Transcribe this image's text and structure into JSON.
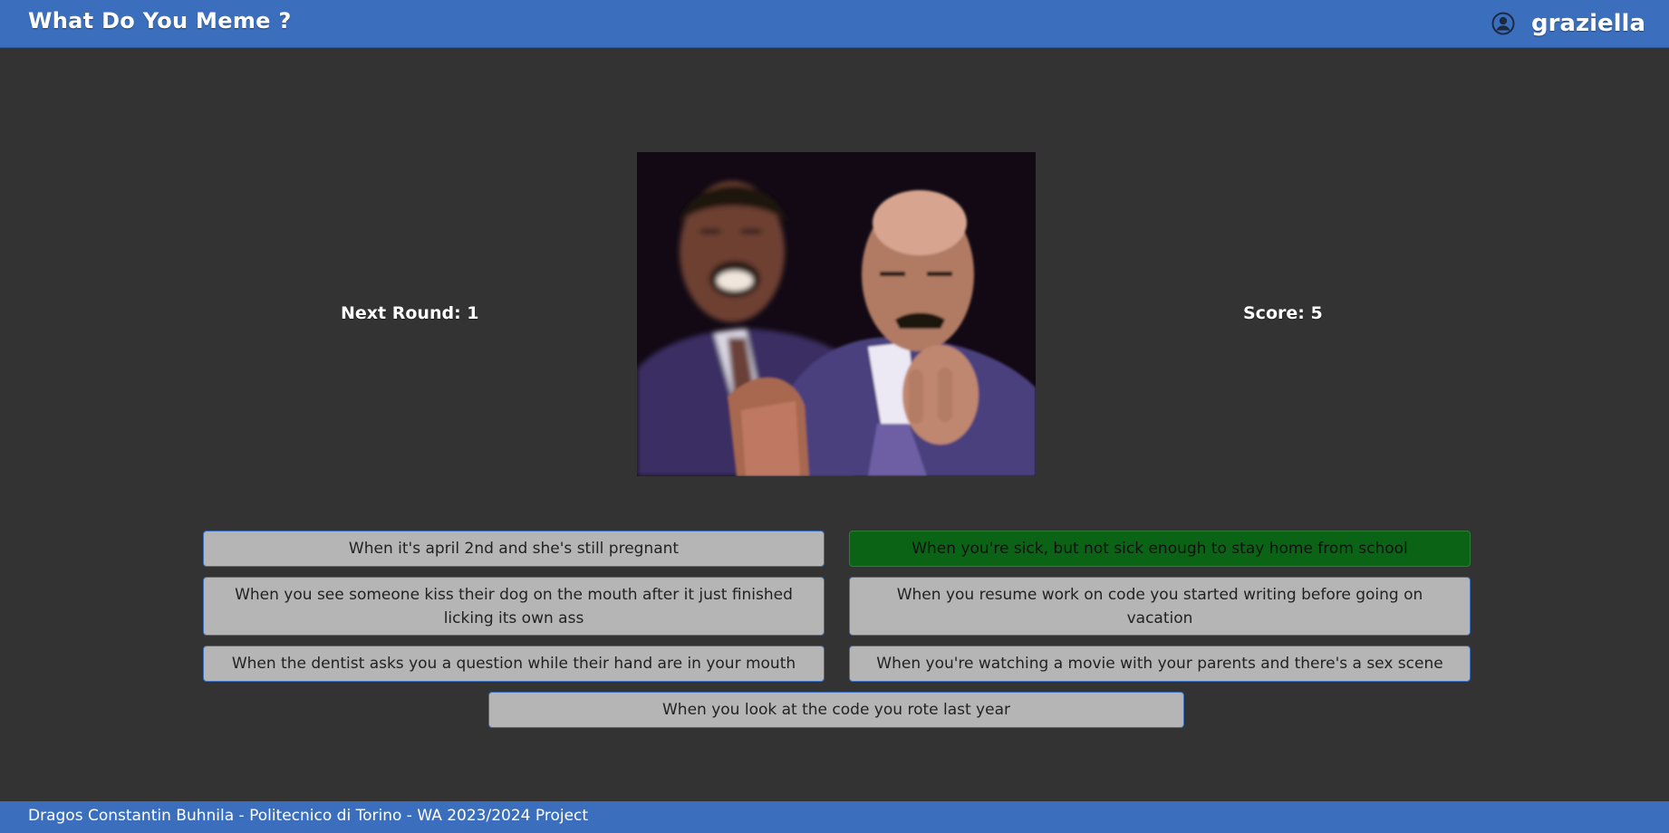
{
  "header": {
    "title": "What Do You Meme ?",
    "username": "graziella",
    "user_icon": "user-circle-icon"
  },
  "game": {
    "next_round_label": "Next Round: 1",
    "score_label": "Score: 5",
    "meme_image": "meme-image",
    "captions": [
      {
        "text": "When it's april 2nd and she's still pregnant",
        "state": "default"
      },
      {
        "text": "When you're sick, but not sick enough to stay home from school",
        "state": "correct"
      },
      {
        "text": "When you see someone kiss their dog on the mouth after it just finished licking its own ass",
        "state": "default"
      },
      {
        "text": "When you resume work on code you started writing before going on vacation",
        "state": "default"
      },
      {
        "text": "When the dentist asks you a question while their hand are in your mouth",
        "state": "default"
      },
      {
        "text": "When you're watching a movie with your parents and there's a sex scene",
        "state": "default"
      },
      {
        "text": "When you look at the code you rote last year",
        "state": "default"
      }
    ]
  },
  "footer": {
    "text": "Dragos Constantin Buhnila - Politecnico di Torino - WA 2023/2024 Project"
  },
  "colors": {
    "navbar": "#3b6fbd",
    "background": "#333333",
    "caption": "#b5b5b5",
    "correct": "#0b6415"
  }
}
